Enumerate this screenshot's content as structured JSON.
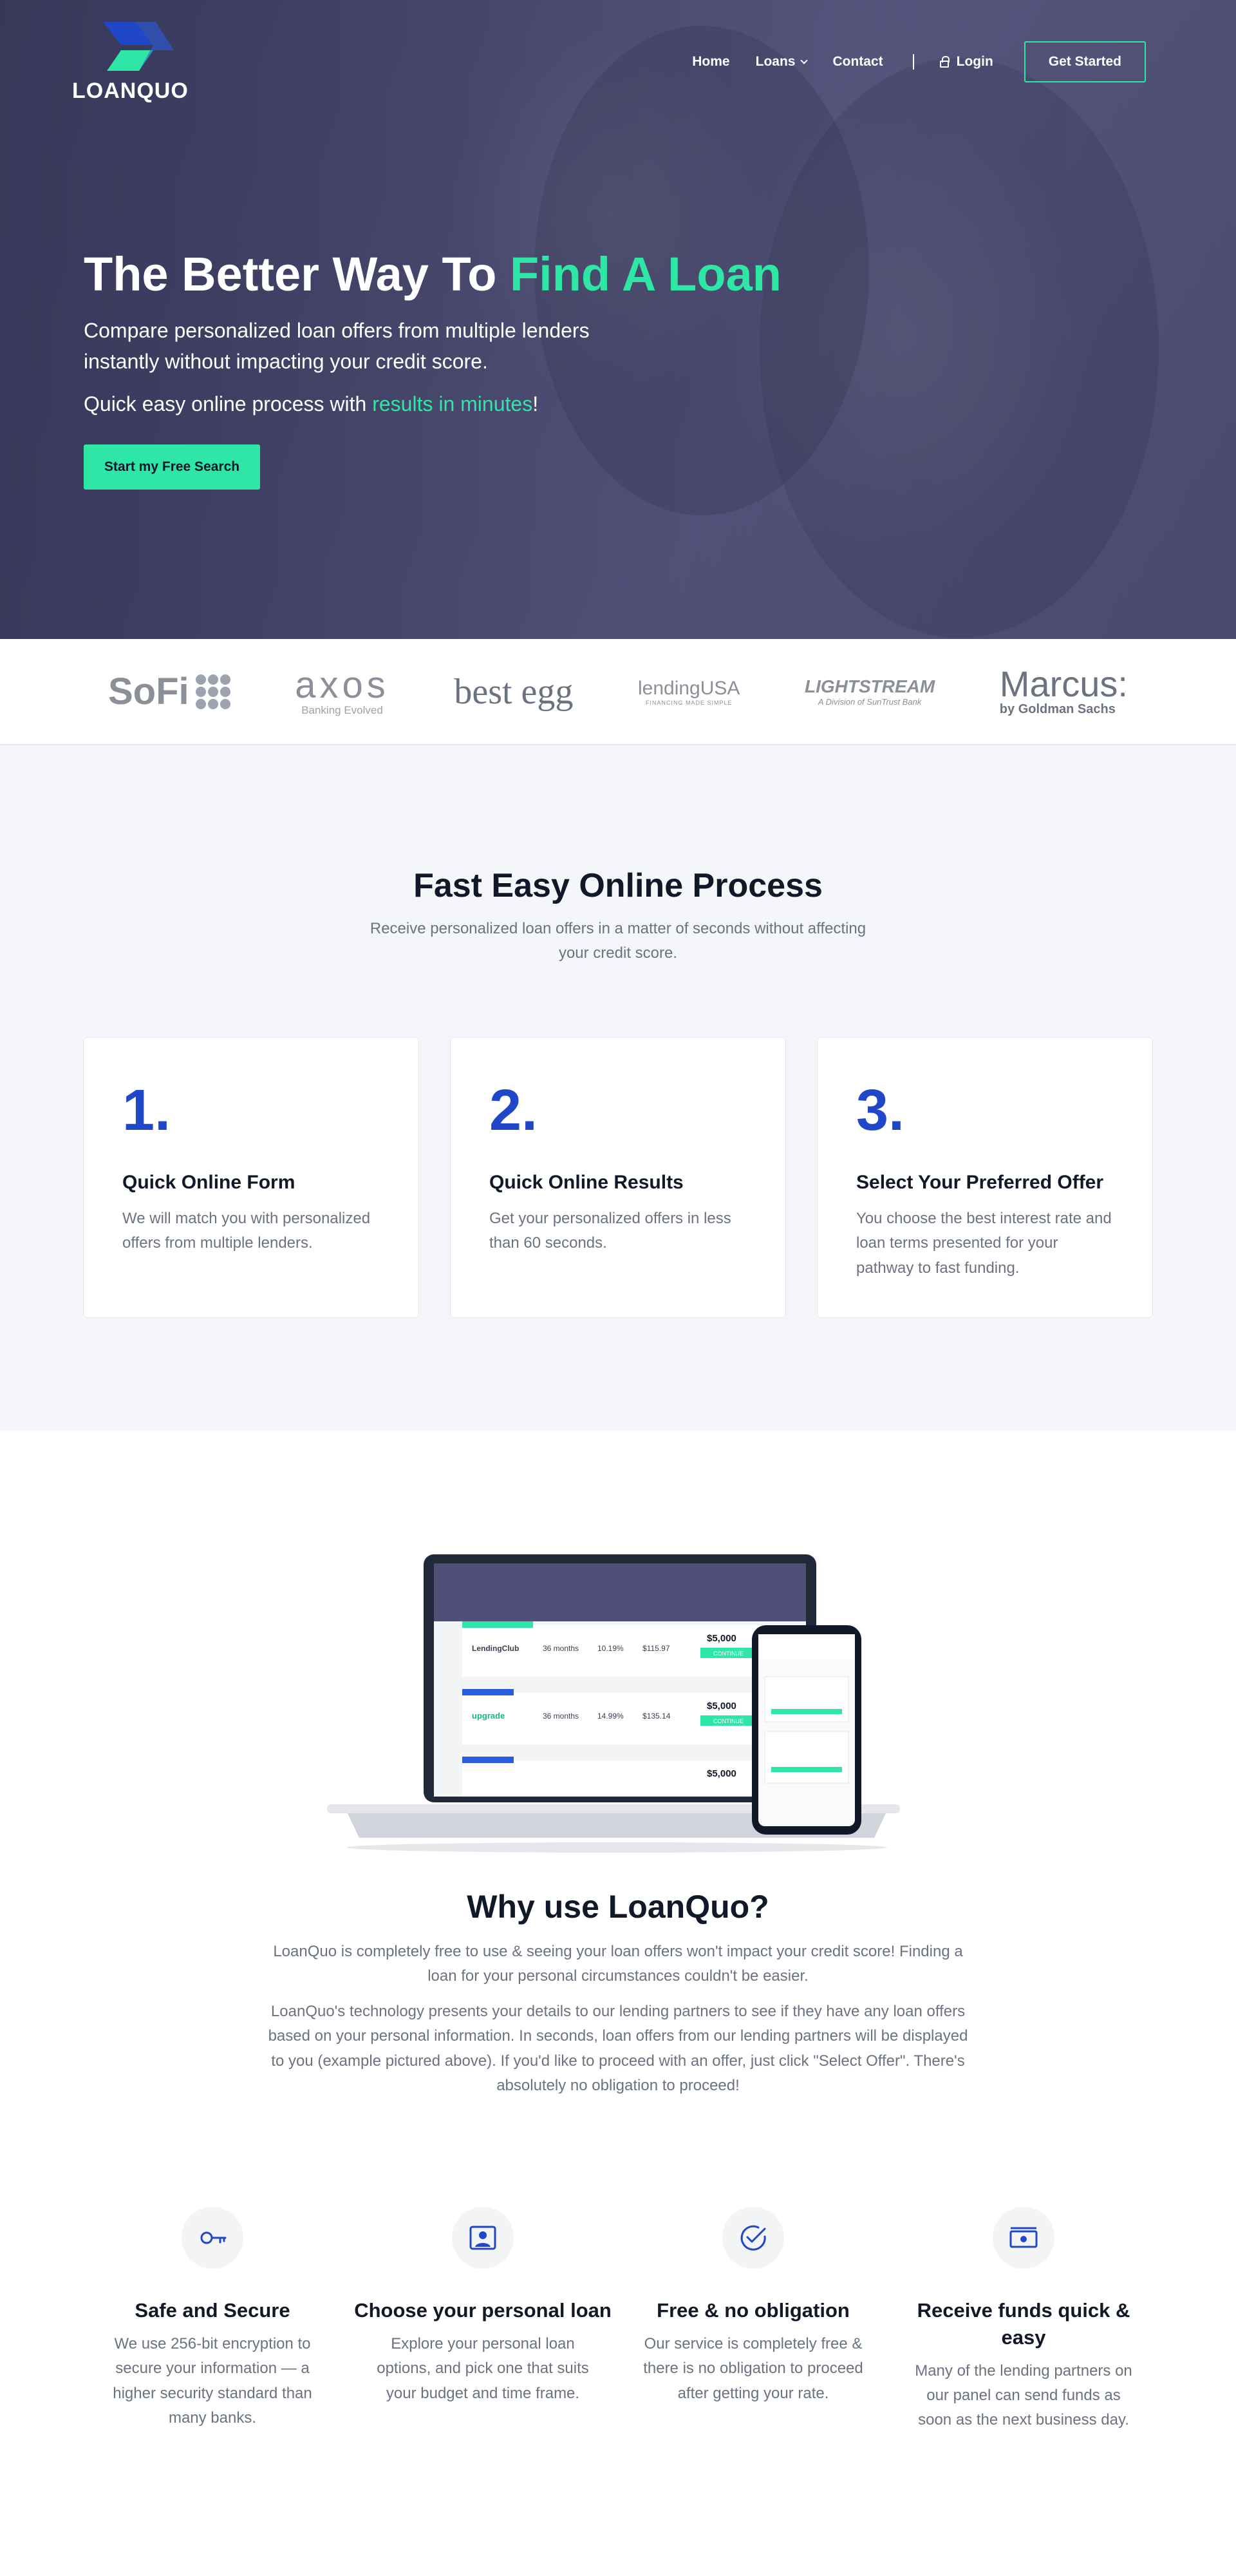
{
  "brand": {
    "name": "LOANQUO"
  },
  "nav": {
    "home": "Home",
    "loans": "Loans",
    "contact": "Contact",
    "login": "Login",
    "get_started": "Get Started"
  },
  "hero": {
    "title_prefix": "The Better Way To ",
    "title_accent": "Find A Loan",
    "subtitle": "Compare personalized loan offers from multiple lenders instantly without impacting your credit score.",
    "quick_prefix": "Quick easy online process with ",
    "quick_accent": "results in minutes",
    "quick_suffix": "!",
    "cta": "Start my Free Search"
  },
  "lenders": {
    "sofi": "SoFi",
    "axos": "axos",
    "axos_tagline": "Banking Evolved",
    "bestegg": "best egg",
    "lendingusa": "lendingUSA",
    "lendingusa_tagline": "FINANCING MADE SIMPLE",
    "lightstream": "LIGHTSTREAM",
    "lightstream_tagline": "A Division of SunTrust Bank",
    "marcus": "Marcus:",
    "marcus_tagline": "by Goldman Sachs"
  },
  "process": {
    "title": "Fast Easy Online Process",
    "subtitle": "Receive personalized loan offers in a matter of seconds without affecting your credit score.",
    "steps": [
      {
        "num": "1.",
        "title": "Quick Online Form",
        "text": "We will match you with personalized offers from multiple lenders."
      },
      {
        "num": "2.",
        "title": "Quick Online Results",
        "text": "Get your personalized offers in less than 60 seconds."
      },
      {
        "num": "3.",
        "title": "Select Your Preferred Offer",
        "text": "You choose the best interest rate and loan terms presented for your pathway to fast funding."
      }
    ]
  },
  "mockup": {
    "offer1_lender": "LendingClub",
    "offer1_term": "36 months",
    "offer1_apr": "10.19%",
    "offer1_payment": "$115.97",
    "offer1_amount": "$5,000",
    "offer2_lender": "upgrade",
    "offer2_term": "36 months",
    "offer2_apr": "14.99%",
    "offer2_payment": "$135.14",
    "offer2_amount": "$5,000",
    "offer3_amount": "$5,000",
    "continue": "CONTINUE"
  },
  "why": {
    "title": "Why use LoanQuo?",
    "p1": "LoanQuo is completely free to use & seeing your loan offers won't impact your credit score! Finding a loan for your personal circumstances couldn't be easier.",
    "p2": "LoanQuo's technology presents your details to our lending partners to see if they have any loan offers based on your personal information. In seconds, loan offers from our lending partners will be displayed to you (example pictured above). If you'd like to proceed with an offer, just click \"Select Offer\". There's absolutely no obligation to proceed!"
  },
  "features": [
    {
      "icon": "key-icon",
      "title": "Safe and Secure",
      "text": "We use 256-bit encryption to secure your information — a higher security standard than many banks."
    },
    {
      "icon": "user-profile-icon",
      "title": "Choose your personal loan",
      "text": "Explore your personal loan options, and pick one that suits your budget and time frame."
    },
    {
      "icon": "check-circle-icon",
      "title": "Free & no obligation",
      "text": "Our service is completely free & there is no obligation to proceed after getting your rate."
    },
    {
      "icon": "cash-icon",
      "title": "Receive funds quick & easy",
      "text": "Many of the lending partners on our panel can send funds as soon as the next business day."
    }
  ],
  "colors": {
    "accent_green": "#2ee6a6",
    "brand_blue": "#2047c7",
    "hero_overlay": "#4f4f77",
    "dark_footer": "#0f172a"
  }
}
